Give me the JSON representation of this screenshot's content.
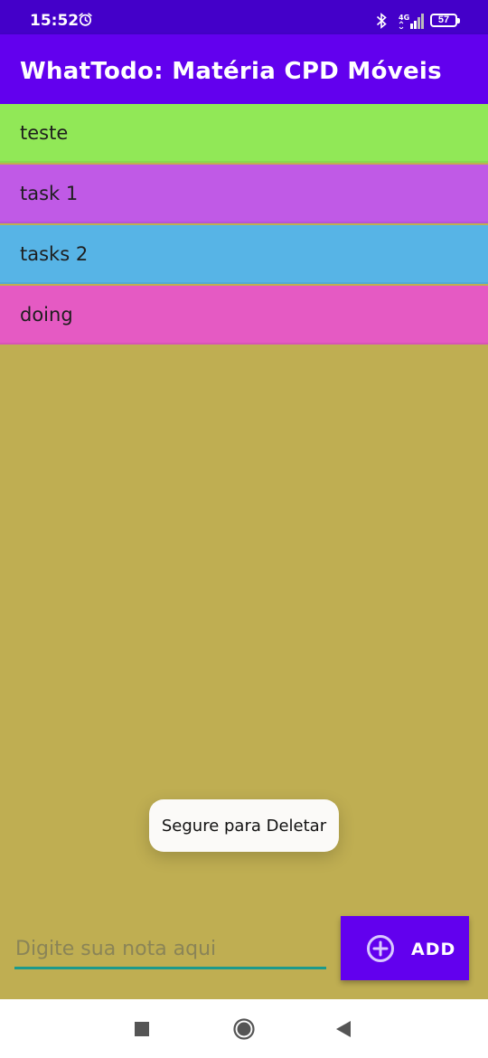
{
  "status_bar": {
    "time": "15:52",
    "alarm_icon": "alarm-clock-icon",
    "bluetooth_icon": "bluetooth-icon",
    "network_label": "4G",
    "battery_level": "57"
  },
  "app_bar": {
    "title": "WhatTodo: Matéria CPD Móveis"
  },
  "tasks": [
    {
      "label": "teste",
      "color": "#91e857"
    },
    {
      "label": "task 1",
      "color": "#c05ae6"
    },
    {
      "label": "tasks 2",
      "color": "#57b4e6"
    },
    {
      "label": "doing",
      "color": "#e55ac3"
    }
  ],
  "toast": {
    "message": "Segure para Deletar"
  },
  "input": {
    "placeholder": "Digite sua nota aqui",
    "value": ""
  },
  "add_button": {
    "label": "ADD",
    "icon": "plus-circle-icon"
  },
  "colors": {
    "background": "#bfae52",
    "primary": "#6200ee",
    "status_bar": "#4400c9",
    "accent": "#1b9a8c"
  }
}
